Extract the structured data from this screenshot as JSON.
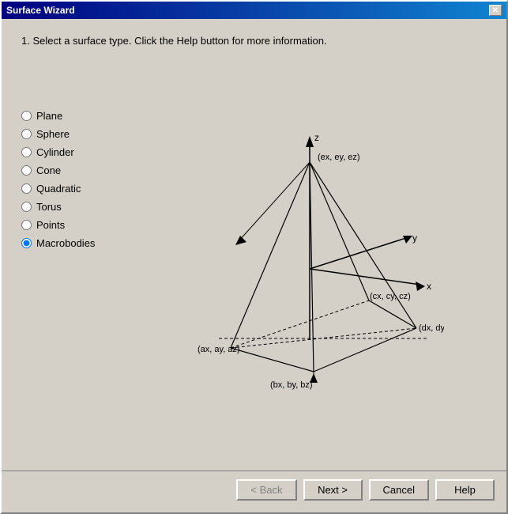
{
  "window": {
    "title": "Surface Wizard",
    "close_label": "✕"
  },
  "instruction": "1.  Select a surface type.  Click the Help button for more information.",
  "radio_options": [
    {
      "id": "plane",
      "label": "Plane",
      "checked": false
    },
    {
      "id": "sphere",
      "label": "Sphere",
      "checked": false
    },
    {
      "id": "cylinder",
      "label": "Cylinder",
      "checked": false
    },
    {
      "id": "cone",
      "label": "Cone",
      "checked": false
    },
    {
      "id": "quadratic",
      "label": "Quadratic",
      "checked": false
    },
    {
      "id": "torus",
      "label": "Torus",
      "checked": false
    },
    {
      "id": "points",
      "label": "Points",
      "checked": false
    },
    {
      "id": "macrobodies",
      "label": "Macrobodies",
      "checked": true
    }
  ],
  "buttons": {
    "back_label": "< Back",
    "next_label": "Next >",
    "cancel_label": "Cancel",
    "help_label": "Help"
  },
  "diagram": {
    "labels": {
      "z": "z",
      "y": "y",
      "x": "x",
      "ex_ey_ez": "(ex, ey, ez)",
      "cx_cy_cz": "(cx, cy, cz)",
      "dx_dy_dz": "(dx, dy, dz)",
      "ax_ay_az": "(ax, ay, az)",
      "bx_by_bz": "(bx, by, bz)"
    }
  }
}
